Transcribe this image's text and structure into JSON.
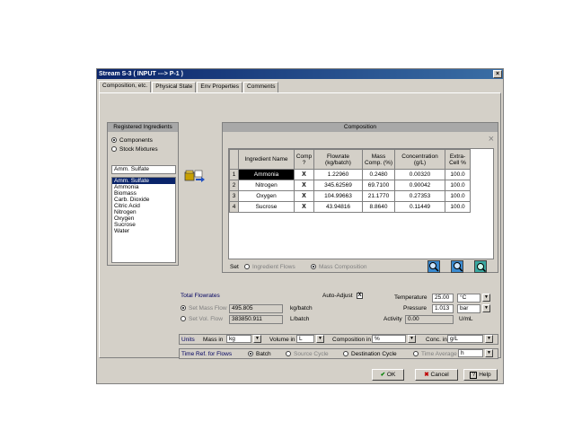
{
  "window": {
    "title": "Stream S-3 ( INPUT ---> P-1 )",
    "close": "×"
  },
  "tabs": [
    {
      "label": "Composition, etc."
    },
    {
      "label": "Physical State"
    },
    {
      "label": "Env Properties"
    },
    {
      "label": "Comments"
    }
  ],
  "ingredients": {
    "header": "Registered Ingredients",
    "radio_components": "Components",
    "radio_stock": "Stock Mixtures",
    "selected": "Amm. Sulfate",
    "list": [
      "Amm. Sulfate",
      "Ammonia",
      "Biomass",
      "Carb. Dioxide",
      "Citric Acid",
      "Nitrogen",
      "Oxygen",
      "Sucrose",
      "Water"
    ]
  },
  "composition": {
    "header": "Composition",
    "close": "×",
    "columns": [
      "Ingredient Name",
      "Comp ?",
      "Flowrate (kg/batch)",
      "Mass Comp. (%)",
      "Concentration (g/L)",
      "Extra-Cell %"
    ],
    "rows": [
      {
        "n": "1",
        "name": "Ammonia",
        "comp": "X",
        "flow": "1.22960",
        "mass": "0.2480",
        "conc": "0.00320",
        "extra": "100.0"
      },
      {
        "n": "2",
        "name": "Nitrogen",
        "comp": "X",
        "flow": "345.62569",
        "mass": "69.7100",
        "conc": "0.90042",
        "extra": "100.0"
      },
      {
        "n": "3",
        "name": "Oxygen",
        "comp": "X",
        "flow": "104.99663",
        "mass": "21.1770",
        "conc": "0.27353",
        "extra": "100.0"
      },
      {
        "n": "4",
        "name": "Sucrose",
        "comp": "X",
        "flow": "43.94816",
        "mass": "8.8640",
        "conc": "0.11449",
        "extra": "100.0"
      }
    ],
    "set_label": "Set",
    "set_flows": "Ingredient Flows",
    "set_comp": "Mass Composition"
  },
  "totals": {
    "header": "Total Flowrates",
    "auto_adjust": "Auto-Adjust",
    "auto_check": "X",
    "mass_label": "Set Mass Flow",
    "mass_value": "495.805",
    "mass_unit": "kg/batch",
    "vol_label": "Set Vol. Flow",
    "vol_value": "383850.911",
    "vol_unit": "L/batch",
    "temp_label": "Temperature",
    "temp_value": "25.00",
    "temp_unit": "°C",
    "press_label": "Pressure",
    "press_value": "1.013",
    "press_unit": "bar",
    "activity_label": "Activity",
    "activity_value": "0.00",
    "activity_unit": "U/mL"
  },
  "units": {
    "label": "Units",
    "mass_label": "Mass in",
    "mass_value": "kg",
    "volume_label": "Volume in",
    "volume_value": "L",
    "comp_label": "Composition in",
    "comp_value": "%",
    "conc_label": "Conc. in",
    "conc_value": "g/L"
  },
  "timeref": {
    "label": "Time Ref. for Flows",
    "batch": "Batch",
    "source": "Source Cycle",
    "dest": "Destination Cycle",
    "avg": "Time Average",
    "avg_unit": "h"
  },
  "buttons": {
    "ok": "OK",
    "cancel": "Cancel",
    "help": "Help",
    "ok_icon": "✔",
    "cancel_icon": "✖",
    "help_icon": "?"
  },
  "dropdown_glyph": "▼",
  "colors": {
    "title_start": "#0a246a",
    "title_end": "#3a6ea5",
    "ok_check": "#008000",
    "cancel_x": "#c00000"
  }
}
